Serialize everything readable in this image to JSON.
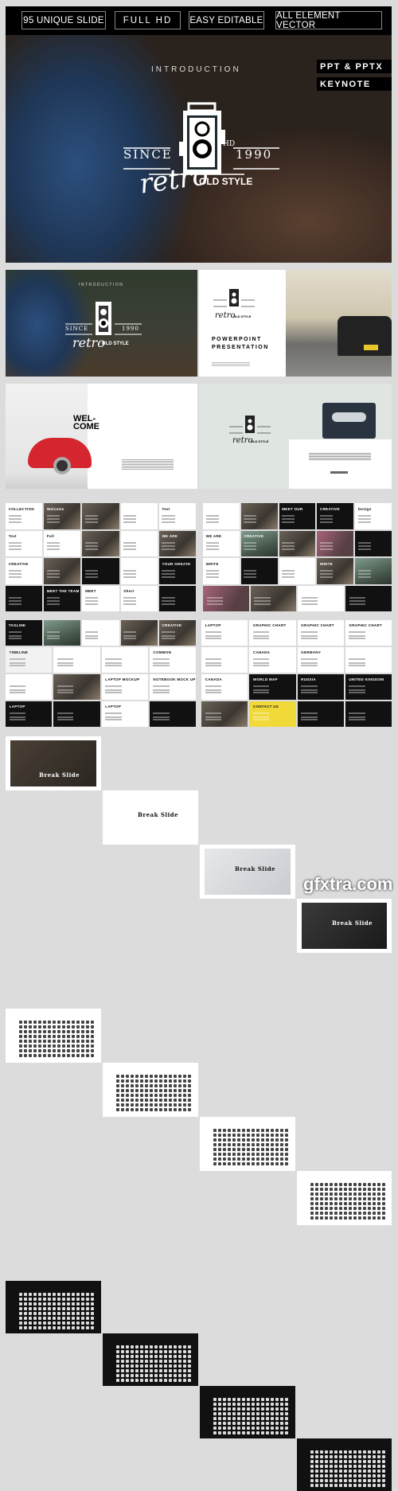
{
  "badges": [
    "95 UNIQUE SLIDE",
    "FULL HD",
    "EASY EDITABLE",
    "ALL ELEMENT VECTOR"
  ],
  "formats": [
    "PPT & PPTX",
    "KEYNOTE"
  ],
  "hero": {
    "intro": "INTRODUCTION",
    "since": "SINCE",
    "year": "1990",
    "hd": "HD",
    "script": "retro",
    "tag": "OLD STYLE"
  },
  "slides": {
    "intro": {
      "intro": "INTRODUCTION",
      "since": "SINCE",
      "year": "1990",
      "script": "retro",
      "tag": "OLD STYLE"
    },
    "powerpoint": {
      "title1": "POWERPOINT",
      "title2": "PRESENTATION",
      "since": "SINCE",
      "year": "1990",
      "script": "retro",
      "tag": "OLD STYLE"
    },
    "welcome": {
      "title1": "WEL-",
      "title2": "COME"
    },
    "cassette": {
      "since": "SINCE",
      "year": "1990",
      "script": "retro",
      "tag": "OLD STYLE"
    }
  },
  "thumb_labels": {
    "grid1": [
      "COLLECTION",
      "Welcome",
      "Text",
      "Text",
      "Full",
      "WE ARE",
      "CREATIVE",
      "YOUR GREATE",
      "MEET THE TEAM",
      "MEET",
      "Short"
    ],
    "grid2": [
      "MEET OUR",
      "CREATIVE",
      "Design",
      "WE ARE",
      "CREATIVE",
      "WRITE",
      "WRITE"
    ],
    "grid3": [
      "TAGLINE",
      "CREATIVE",
      "TIMELINE",
      "COMMON",
      "LAPTOP MOCKUP",
      "NOTEBOOK MOCK UP",
      "LAPTOP",
      "LAPTOP"
    ],
    "grid4": [
      "LAPTOP",
      "GRAPHIC CHART",
      "GRAPHIC CHART",
      "GRAPHIC CHART",
      "CANADA",
      "GERMANY",
      "CANADA",
      "WORLD MAP",
      "RUSSIA",
      "UNITED KINGDOM",
      "CONTACT US"
    ]
  },
  "break_slide": "Break Slide",
  "colors": {
    "background": "#dcdcdc",
    "dark": "#000000",
    "accent_yellow": "#f1d93a"
  },
  "watermark": "gfxtra.com"
}
